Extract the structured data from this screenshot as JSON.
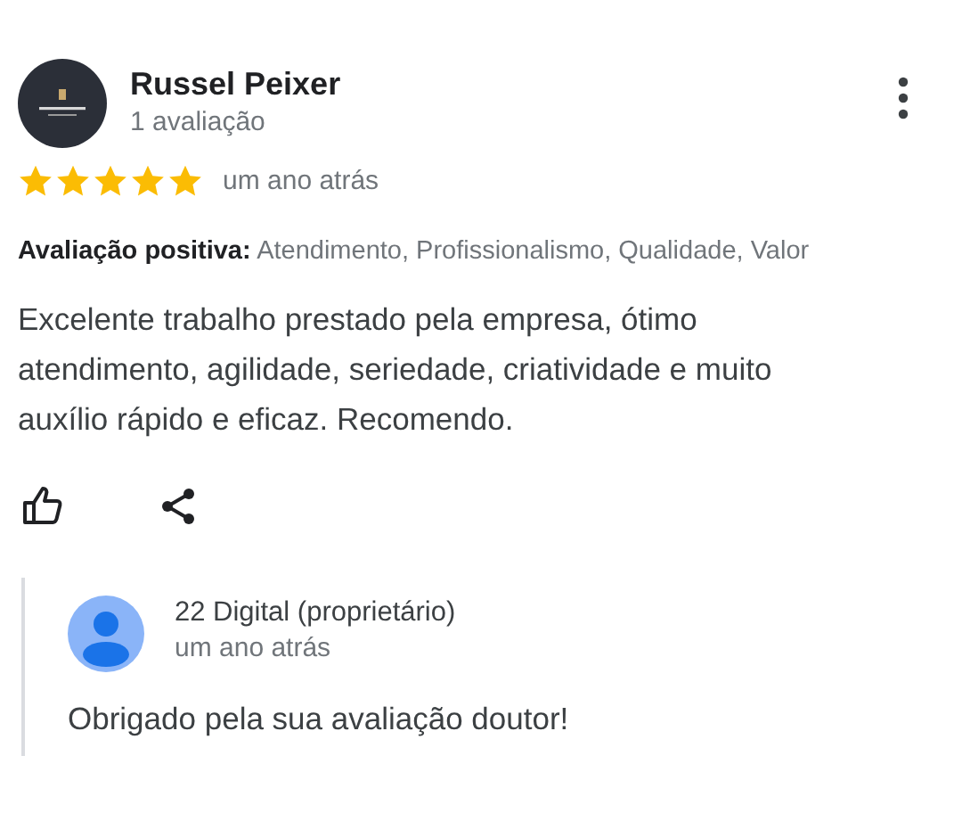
{
  "review": {
    "author": "Russel Peixer",
    "author_meta": "1 avaliação",
    "stars": 5,
    "time": "um ano atrás",
    "highlights_label": "Avaliação positiva:",
    "highlights": "Atendimento, Profissionalismo, Qualidade, Valor",
    "text": "Excelente trabalho prestado pela empresa, ótimo atendimento, agilidade, seriedade, criatividade e muito auxílio rápido e eficaz. Recomendo."
  },
  "reply": {
    "author": "22 Digital (proprietário)",
    "time": "um ano atrás",
    "text": "Obrigado pela sua avaliação doutor!"
  }
}
